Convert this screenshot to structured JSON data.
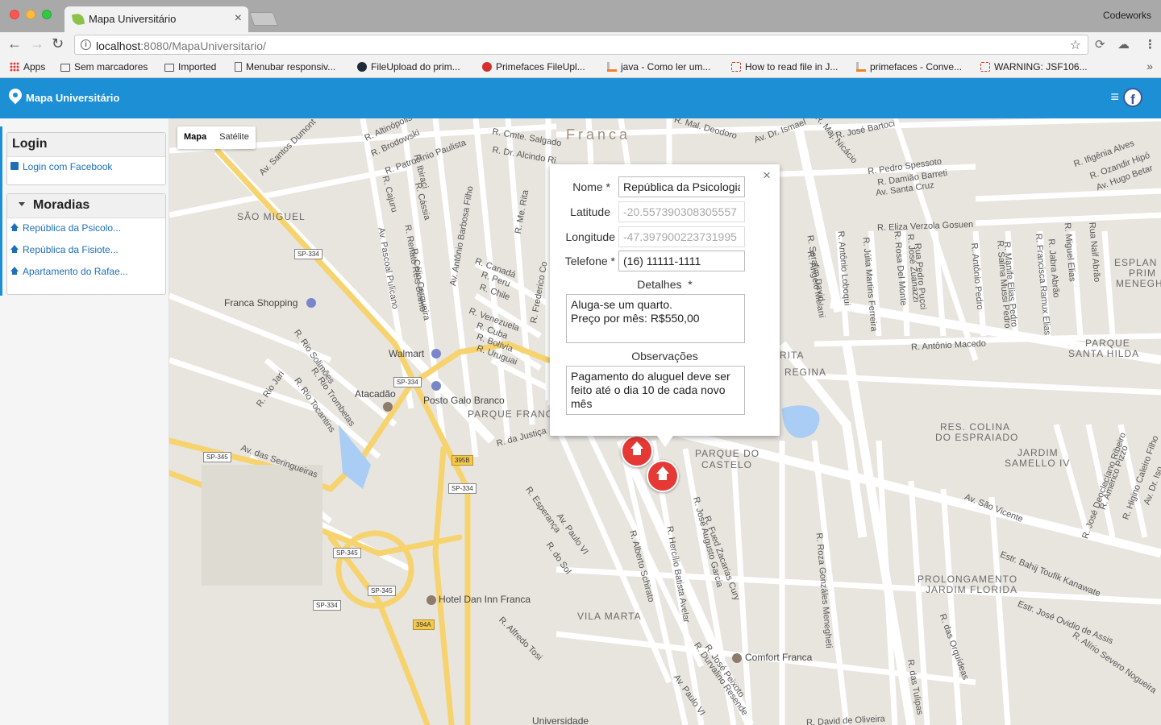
{
  "browser": {
    "tab_title": "Mapa Universitário",
    "profile": "Codeworks",
    "url_host": "localhost",
    "url_rest": ":8080/MapaUniversitario/",
    "bookmarks": [
      {
        "label": "Apps",
        "icon": "apps-icon"
      },
      {
        "label": "Sem marcadores",
        "icon": "folder-icon"
      },
      {
        "label": "Imported",
        "icon": "folder-icon"
      },
      {
        "label": "Menubar responsiv...",
        "icon": "page-icon"
      },
      {
        "label": "FileUpload do prim...",
        "icon": "primefaces-icon"
      },
      {
        "label": "Primefaces FileUpl...",
        "icon": "primefaces-icon"
      },
      {
        "label": "java - Como ler um...",
        "icon": "stackoverflow-icon"
      },
      {
        "label": "How to read file in J...",
        "icon": "question-icon"
      },
      {
        "label": "primefaces - Conve...",
        "icon": "stackoverflow-icon"
      },
      {
        "label": "WARNING: JSF106...",
        "icon": "question-icon"
      }
    ]
  },
  "app": {
    "brand": "Mapa Universitário",
    "colors": {
      "primary": "#1d8fd4",
      "marker": "#e53935"
    }
  },
  "sidebar": {
    "login_title": "Login",
    "login_link": "Login com Facebook",
    "moradias_title": "Moradias",
    "moradias": [
      "República da Psicolo...",
      "República da Fisiote...",
      "Apartamento do Rafae..."
    ]
  },
  "map": {
    "type_buttons": [
      "Mapa",
      "Satélite"
    ],
    "districts": [
      "SÃO MIGUEL",
      "PARQUE FRANCAL",
      "PARQUE DO",
      "CASTELO",
      "VILA MARTA",
      "RES. COLINA",
      "DO ESPRAIADO",
      "JARDIM",
      "SAMELLO IV",
      "PROLONGAMENTO",
      "JARDIM FLORIDA",
      "PARQUE",
      "SANTA HILDA",
      "ESPLAN",
      "PRIM",
      "MENEGH",
      "REGINA",
      "RITA",
      "Franca"
    ],
    "pois": [
      "Franca Shopping",
      "Walmart",
      "Atacadão",
      "Posto Galo Branco",
      "Hotel Dan Inn Franca",
      "Comfort Franca",
      "Universidade"
    ],
    "streets": [
      "R. Altinópolis",
      "R. Brodowski",
      "R. Patrocínio Paulista",
      "R. Cmte. Salgado",
      "R. Dr. Alcindo Ri",
      "R. Mal. Deodoro",
      "Av. Santos Dumont",
      "Av. Antônio Barbosa Filho",
      "R. Ibiraci",
      "R. Cajuru",
      "R. Cássia",
      "R. Renato Reis Bueno",
      "Av. Pascoal Pulicano",
      "R. Célio Cerqueira",
      "R. Canadá",
      "R. Peru",
      "R. Chile",
      "R. Venezuela",
      "R. Cuba",
      "R. Bolívia",
      "R. Uruguai",
      "R. Me. Rita",
      "R. Frederico Co",
      "R. Rio Solimões",
      "R. Rio Jari",
      "R. Rio Trombetas",
      "R. Rio Tocantins",
      "Av. das Seringueiras",
      "R. da Justiça",
      "R. Esperança",
      "Av. Paulo VI",
      "R. do Sol",
      "R. Alfredo Tosi",
      "R. Alberto Schirato",
      "R. José Augusto Garcia",
      "R. Fued Zacarias Cury",
      "R. Hercílio Batista Avelar",
      "R. Durvalino Resende",
      "R. José Peixoto",
      "Av. Paulo VI",
      "R. Roza Gonzáles Menegheti",
      "R. Eliza Verzola Gosuen",
      "Av. Santa Cruz",
      "R. Pedro Spessoto",
      "R. Damião Barreti",
      "R. José Bartoci",
      "R. Maj. Nicácio",
      "Av. Dr. Ismael",
      "R. Ifigênia Alves",
      "R. Ozandir Hipó",
      "Av. Hugo Betar",
      "R. Antônio Macedo",
      "Av. São Vicente",
      "Estr. Bahij Toufik Kanawate",
      "Estr. José Ovidio de Assis",
      "R. Alírio Severo Nogueira",
      "R. das Orquídeas",
      "R. das Tulipas",
      "R. David de Oliveira",
      "R. Serafim David",
      "R. Antônio Loboqui",
      "R. Júlia Martins Ferreira",
      "R. Rosa Del Monte",
      "R. José Zuanazzi",
      "Rua Pedro Pucci",
      "R. Salma Mussi Pedro",
      "R. Manife Elias Pedro",
      "R. Antônio Pedro",
      "R. Francisca Ramux Elias",
      "R. Jabra Abrão",
      "R. Miguel Elias",
      "Rua Naif Abrão",
      "R. José Deoclecíano Ribeiro",
      "R. Américo Pizzo",
      "R. Higino Caleiro Filho",
      "Av. Dr. Iso",
      "R. Ângelo Melani"
    ],
    "shields": [
      "SP-334",
      "SP-334",
      "SP-334",
      "SP-345",
      "SP-345",
      "SP-345",
      "SP-334",
      "395B",
      "394A"
    ]
  },
  "infowindow": {
    "nome_label": "Nome",
    "nome_value": "República da Psicologia",
    "latitude_label": "Latitude",
    "latitude_value": "-20.557390308305557",
    "longitude_label": "Longitude",
    "longitude_value": "-47.397900223731995",
    "telefone_label": "Telefone",
    "telefone_value": "(16) 11111-1111",
    "detalhes_label": "Detalhes",
    "detalhes_value": "Aluga-se um quarto.\nPreço por mês: R$550,00",
    "observacoes_label": "Observações",
    "observacoes_value": "Pagamento do aluguel deve ser feito até o dia 10 de cada novo mês",
    "required_mark": "*"
  }
}
